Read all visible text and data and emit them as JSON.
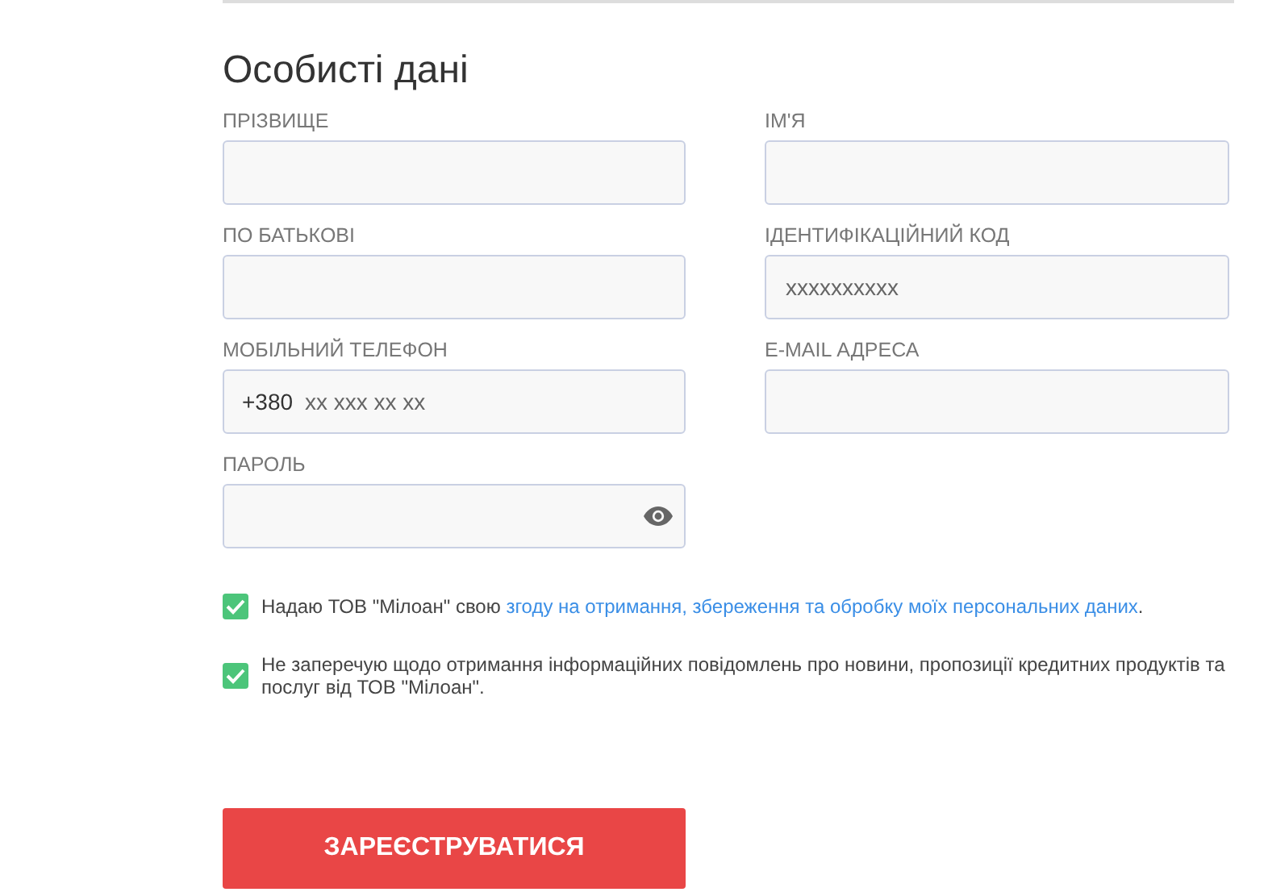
{
  "title": "Особисті дані",
  "fields": [
    {
      "label": "ПРІЗВИЩЕ",
      "kind": "text"
    },
    {
      "label": "ІМ'Я",
      "kind": "text"
    },
    {
      "label": "ПО БАТЬКОВІ",
      "kind": "text"
    },
    {
      "label": "ІДЕНТИФІКАЦІЙНИЙ КОД",
      "kind": "text",
      "placeholder": "xxxxxxxxxx"
    },
    {
      "label": "МОБІЛЬНИЙ ТЕЛЕФОН",
      "kind": "phone",
      "prefix": "+380",
      "placeholder": "xx xxx xx xx"
    },
    {
      "label": "E-MAIL АДРЕСА",
      "kind": "text"
    },
    {
      "label": "ПАРОЛЬ",
      "kind": "password"
    }
  ],
  "consents": [
    {
      "checked": true,
      "text": "Надаю ТОВ \"Мілоан\" свою ",
      "link": "згоду на отримання, збереження та обробку моїх персональних даних",
      "after": "."
    },
    {
      "checked": true,
      "text": "Не заперечую щодо отримання інформаційних повідомлень про новини, пропозиції кредитних продуктів та послуг від ТОВ \"Мілоан\"."
    }
  ],
  "submit": "ЗАРЕЄСТРУВАТИСЯ"
}
